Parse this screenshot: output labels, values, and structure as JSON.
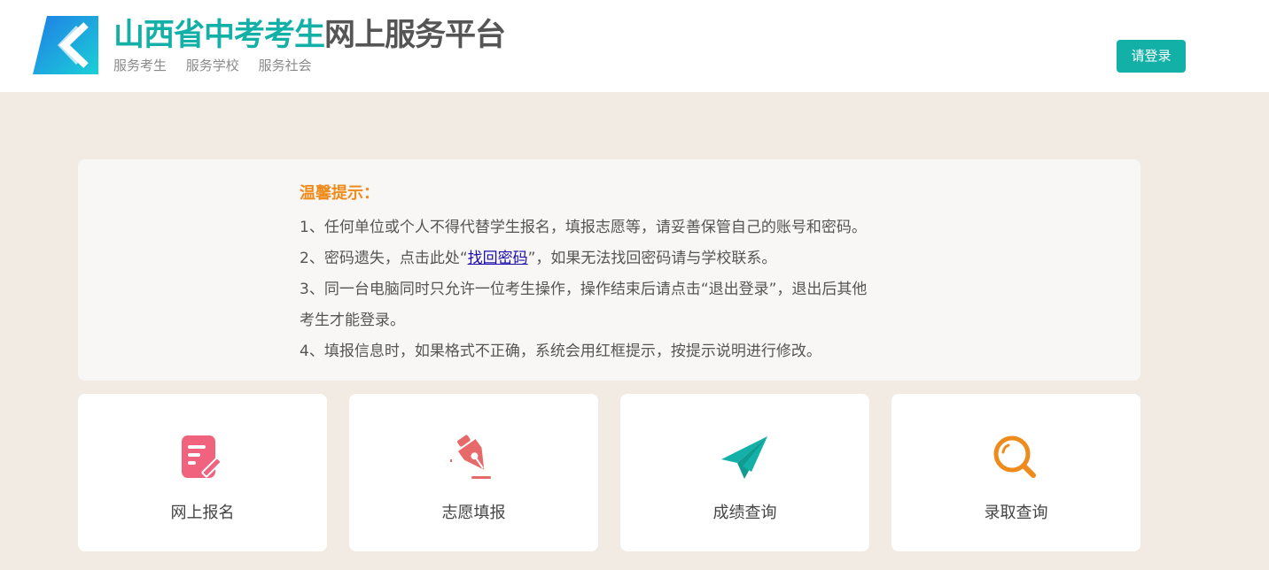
{
  "header": {
    "title_part1": "山西省中考考生",
    "title_part2": "网上服务平台",
    "subtitles": [
      "服务考生",
      "服务学校",
      "服务社会"
    ],
    "login_label": "请登录"
  },
  "notice": {
    "title": "温馨提示：",
    "item1": "1、任何单位或个人不得代替学生报名，填报志愿等，请妥善保管自己的账号和密码。",
    "item2_prefix": "2、密码遗失，点击此处“",
    "item2_link": "找回密码",
    "item2_suffix": "”，如果无法找回密码请与学校联系。",
    "item3_line1": "3、同一台电脑同时只允许一位考生操作，操作结束后请点击“退出登录”，退出后其他",
    "item3_line2": "考生才能登录。",
    "item4": "4、填报信息时，如果格式不正确，系统会用红框提示，按提示说明进行修改。"
  },
  "cards": [
    {
      "label": "网上报名",
      "icon": "edit-form-icon"
    },
    {
      "label": "志愿填报",
      "icon": "pen-nib-icon"
    },
    {
      "label": "成绩查询",
      "icon": "paper-plane-icon"
    },
    {
      "label": "录取查询",
      "icon": "search-icon"
    }
  ],
  "colors": {
    "brand_teal": "#13b0a8",
    "notice_orange": "#ef8b1c",
    "pink": "#f0627d",
    "salmon": "#e8696a",
    "orange": "#ef8b1c",
    "background": "#f1ebe4"
  }
}
